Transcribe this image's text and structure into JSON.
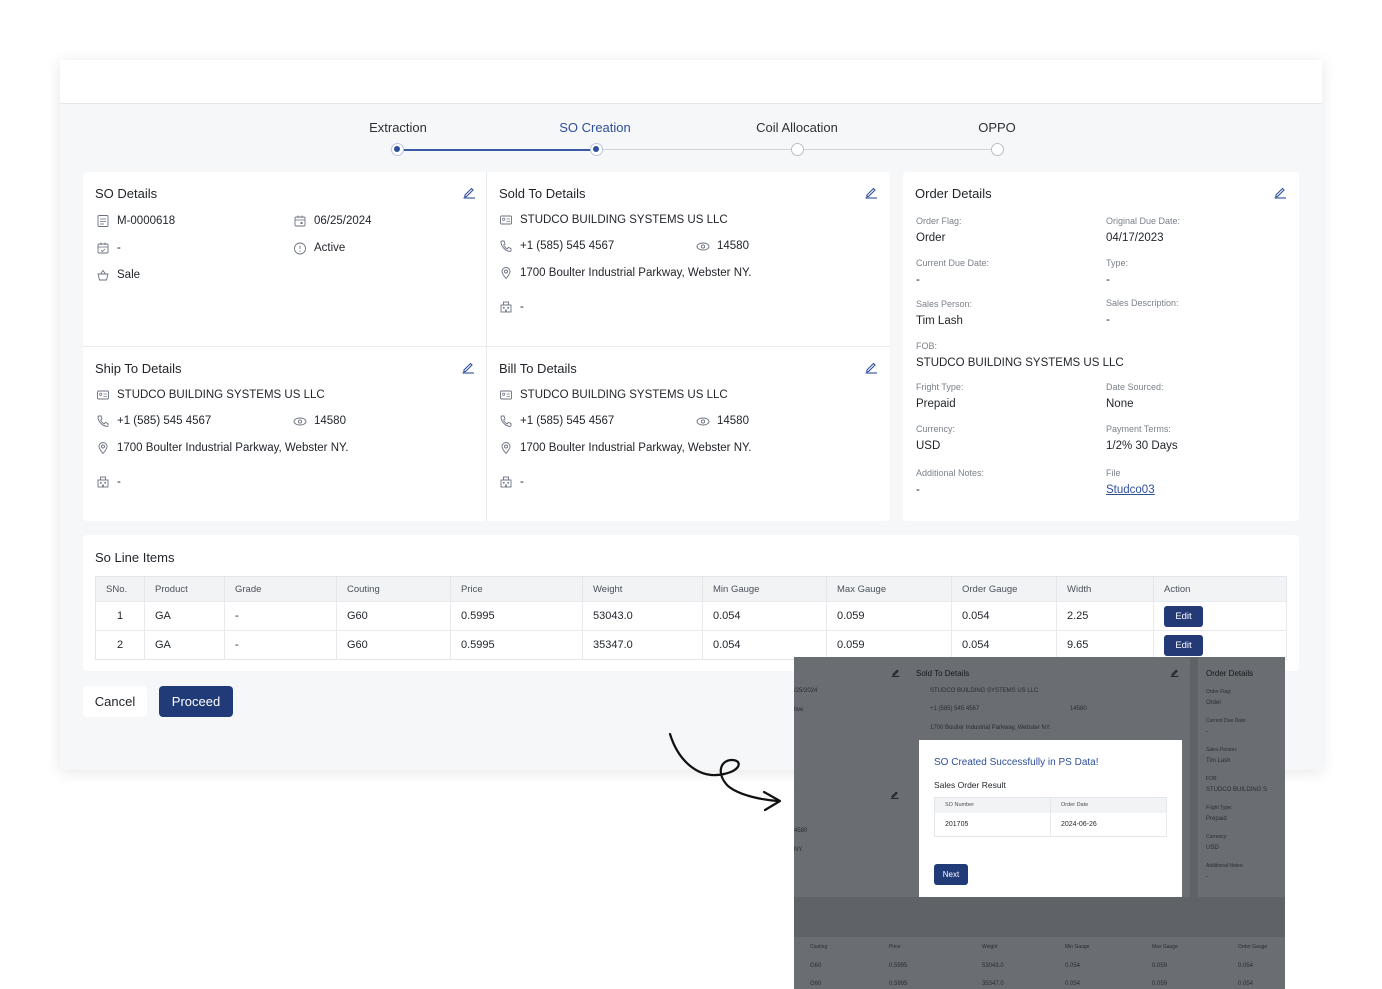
{
  "stepper": [
    {
      "label": "Extraction",
      "state": "done"
    },
    {
      "label": "SO Creation",
      "state": "active"
    },
    {
      "label": "Coil Allocation",
      "state": "pending"
    },
    {
      "label": "OPPO",
      "state": "pending"
    }
  ],
  "so_details": {
    "title": "SO Details",
    "so_number": "M-0000618",
    "date": "06/25/2024",
    "due": "-",
    "status": "Active",
    "type": "Sale"
  },
  "sold_to": {
    "title": "Sold To Details",
    "company": "STUDCO BUILDING SYSTEMS US LLC",
    "phone": "+1 (585) 545 4567",
    "zip": "14580",
    "address": "1700 Boulter Industrial Parkway, Webster NY.",
    "extra": "-"
  },
  "ship_to": {
    "title": "Ship To Details",
    "company": "STUDCO BUILDING SYSTEMS US LLC",
    "phone": "+1 (585) 545 4567",
    "zip": "14580",
    "address": "1700 Boulter Industrial Parkway, Webster NY.",
    "extra": "-"
  },
  "bill_to": {
    "title": "Bill To Details",
    "company": "STUDCO BUILDING SYSTEMS US LLC",
    "phone": "+1 (585) 545 4567",
    "zip": "14580",
    "address": "1700 Boulter Industrial Parkway, Webster NY.",
    "extra": "-"
  },
  "order_details": {
    "title": "Order Details",
    "order_flag_label": "Order Flag:",
    "order_flag": "Order",
    "original_due_label": "Original Due Date:",
    "original_due": "04/17/2023",
    "current_due_label": "Current Due Date:",
    "current_due": "-",
    "type_label": "Type:",
    "type": "-",
    "sales_person_label": "Sales Person:",
    "sales_person": "Tim Lash",
    "sales_desc_label": "Sales Description:",
    "sales_desc": "-",
    "fob_label": "FOB:",
    "fob": "STUDCO BUILDING SYSTEMS US LLC",
    "fright_label": "Fright Type:",
    "fright": "Prepaid",
    "date_sourced_label": "Date Sourced:",
    "date_sourced": "None",
    "currency_label": "Currency:",
    "currency": "USD",
    "payment_label": "Payment Terms:",
    "payment": "1/2% 30 Days",
    "notes_label": "Additional Notes:",
    "notes": "-",
    "file_label": "File",
    "file": "Studco03"
  },
  "line_items": {
    "title": "So Line Items",
    "columns": [
      "SNo.",
      "Product",
      "Grade",
      "Couting",
      "Price",
      "Weight",
      "Min Gauge",
      "Max Gauge",
      "Order Gauge",
      "Width",
      "Action"
    ],
    "rows": [
      [
        "1",
        "GA",
        "-",
        "G60",
        "0.5995",
        "53043.0",
        "0.054",
        "0.059",
        "0.054",
        "2.25"
      ],
      [
        "2",
        "GA",
        "-",
        "G60",
        "0.5995",
        "35347.0",
        "0.054",
        "0.059",
        "0.054",
        "9.65"
      ]
    ],
    "edit_label": "Edit"
  },
  "actions": {
    "cancel": "Cancel",
    "proceed": "Proceed"
  },
  "inset": {
    "sold_title": "Sold To Details",
    "sold_company": "STUDCO BUILDING SYSTEMS US LLC",
    "sold_phone": "+1 (585) 545 4567",
    "sold_zip": "14580",
    "sold_address": "1700 Boulter Industrial Parkway, Webster NY.",
    "order_title": "Order Details",
    "order_flag_label": "Order Flag:",
    "order_flag": "Order",
    "current_due_label": "Current Due Date:",
    "current_due": "-",
    "sales_person_label": "Sales Person:",
    "sales_person": "Tim Lash",
    "fob_label": "FOB:",
    "fob": "STUDCO BUILDING S",
    "fright_label": "Fright Type:",
    "fright": "Prepaid",
    "currency_label": "Currency:",
    "currency": "USD",
    "notes_label": "Additional Notes:",
    "notes": "-",
    "left_date": "/25/2024",
    "left_status": "tive",
    "left_zip": "4580",
    "left_ny": "NY.",
    "modal_title": "SO Created Successfully in PS Data!",
    "modal_sub": "Sales Order Result",
    "modal_cols": [
      "SO Number",
      "Order Date"
    ],
    "modal_row": [
      "201705",
      "2024-06-26"
    ],
    "next": "Next",
    "table_cols": [
      "Couting",
      "Price",
      "Weight",
      "Min Gauge",
      "Max Gauge",
      "Order Gauge"
    ],
    "table_rows": [
      [
        "G60",
        "0.5995",
        "53043.0",
        "0.054",
        "0.059",
        "0.054"
      ],
      [
        "G60",
        "0.5995",
        "35347.0",
        "0.054",
        "0.059",
        "0.054"
      ]
    ]
  }
}
